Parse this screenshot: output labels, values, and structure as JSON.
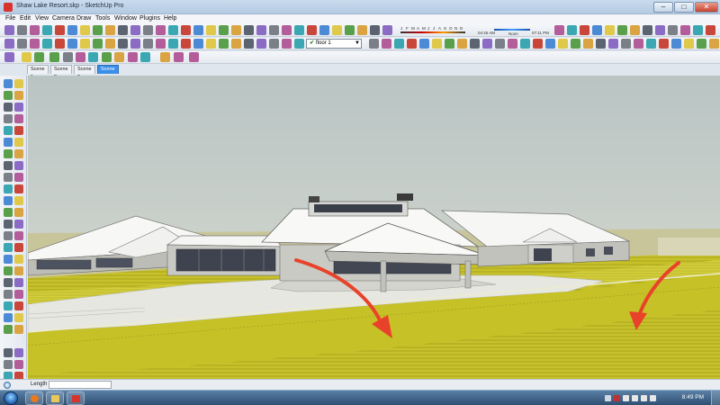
{
  "window": {
    "title": "Shaw Lake Resort.skp - SketchUp Pro",
    "minimize_icon": "minimize-icon",
    "maximize_icon": "maximize-icon",
    "close_icon": "close-icon",
    "minimize_glyph": "–",
    "maximize_glyph": "□",
    "close_glyph": "✕"
  },
  "menu": {
    "items": [
      "File",
      "Edit",
      "View",
      "Camera",
      "Draw",
      "Tools",
      "Window",
      "Plugins",
      "Help"
    ]
  },
  "toolbar": {
    "layer_check": "✔",
    "layer_value": "floor 1",
    "layer_arrow": "▼"
  },
  "shadow": {
    "months": [
      "J",
      "F",
      "M",
      "A",
      "M",
      "J",
      "J",
      "A",
      "S",
      "O",
      "N",
      "D"
    ],
    "time_start": "04:45 AM",
    "noon_label": "Noon",
    "time_end": "07:11 PM"
  },
  "scenes": {
    "tabs": [
      "Scene 1",
      "Scene 2",
      "Scene 3",
      "Scene 4"
    ],
    "active_index": 3
  },
  "status": {
    "length_label": "Length",
    "length_value": ""
  },
  "taskbar": {
    "clock": "8:49 PM",
    "start_icon": "windows-start-icon"
  },
  "colors": {
    "arrow": "#e8432a",
    "grass": "#c9c62b",
    "roof": "#f4f4f2",
    "accent_tab": "#3c8fe8"
  }
}
